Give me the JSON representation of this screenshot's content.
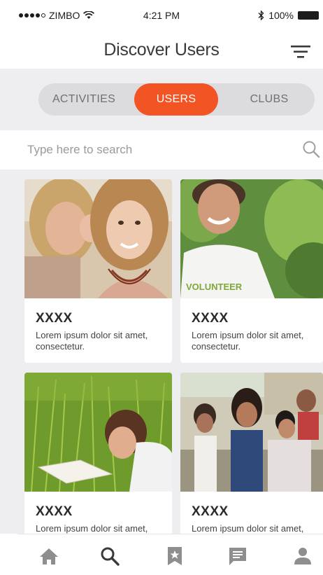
{
  "status_bar": {
    "carrier": "ZIMBO",
    "time": "4:21 PM",
    "battery": "100%"
  },
  "nav": {
    "title": "Discover Users"
  },
  "tabs": [
    {
      "label": "ACTIVITIES",
      "active": false
    },
    {
      "label": "USERS",
      "active": true
    },
    {
      "label": "CLUBS",
      "active": false
    }
  ],
  "search": {
    "placeholder": "Type here to search",
    "value": ""
  },
  "cards": [
    {
      "name": "XXXX",
      "description": "Lorem ipsum dolor sit amet, consectetur."
    },
    {
      "name": "XXXX",
      "description": "Lorem ipsum dolor sit amet, consectetur.",
      "shirt_text": "VOLUNTEER"
    },
    {
      "name": "XXXX",
      "description": "Lorem ipsum dolor sit amet, consectetur."
    },
    {
      "name": "XXXX",
      "description": "Lorem ipsum dolor sit amet, consectetur."
    }
  ],
  "bottom_tabs": [
    {
      "icon": "home-icon"
    },
    {
      "icon": "search-icon",
      "active": true
    },
    {
      "icon": "badge-icon"
    },
    {
      "icon": "message-icon"
    },
    {
      "icon": "profile-icon"
    }
  ],
  "colors": {
    "accent": "#f25424",
    "background": "#eeeef0",
    "icon_gray": "#8e8e8e",
    "icon_active": "#3a3a3a"
  }
}
